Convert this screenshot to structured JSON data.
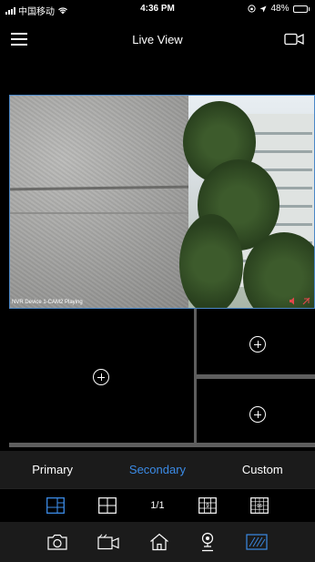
{
  "status_bar": {
    "carrier": "中国移动",
    "time": "4:36 PM",
    "battery": "48%",
    "battery_level": 0.48
  },
  "header": {
    "title": "Live View",
    "menu_icon": "hamburger-icon",
    "camera_icon": "video-camera-icon"
  },
  "main_view": {
    "label": "NVR Device 1-CAM2 Playing",
    "icons": [
      "audio-icon",
      "record-icon"
    ]
  },
  "empty_tiles": [
    "add-camera-1",
    "add-camera-2",
    "add-camera-3"
  ],
  "tabs": [
    {
      "label": "Primary",
      "active": false
    },
    {
      "label": "Secondary",
      "active": true
    },
    {
      "label": "Custom",
      "active": false
    }
  ],
  "layout_bar": {
    "page": "1/1",
    "icons": [
      "layout-1plus3-icon",
      "layout-4-icon",
      "layout-9-icon",
      "layout-16-icon"
    ],
    "layout_9_label": "9",
    "layout_16_label": "16"
  },
  "toolbar": {
    "icons": [
      "snapshot-icon",
      "video-record-icon",
      "home-icon",
      "location-icon",
      "fullscreen-icon"
    ]
  },
  "colors": {
    "accent": "#3b8be6",
    "bar_background": "#1b1b1b"
  }
}
